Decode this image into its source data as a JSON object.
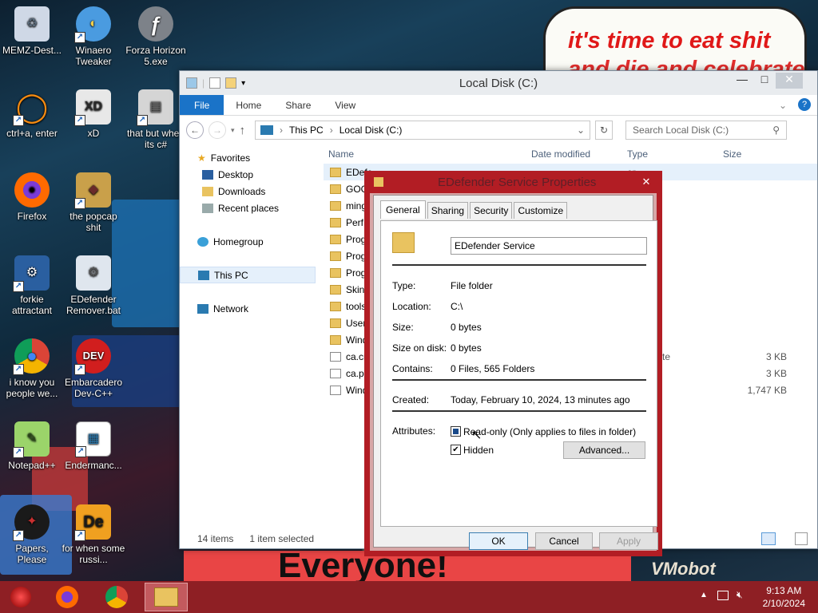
{
  "desktop": {
    "speech_line1": "it's time to eat shit",
    "speech_line2": "and die and celebrate",
    "poster_text": "Everyone!",
    "watermark_text": "VMobot",
    "icons": [
      {
        "label": "MEMZ-Dest...",
        "icon": "recycle-bin-icon",
        "color": "#cfd8e6",
        "glyph": "♻"
      },
      {
        "label": "Winaero Tweaker",
        "icon": "winaero-icon",
        "color": "#4a9be0",
        "glyph": "◐"
      },
      {
        "label": "Forza Horizon 5.exe",
        "icon": "flash-icon",
        "color": "#8a8f96",
        "glyph": "ƒ"
      },
      {
        "label": "ctrl+a, enter",
        "icon": "orange-ring-icon",
        "color": "#222",
        "glyph": "◯"
      },
      {
        "label": "xD",
        "icon": "hxd-icon",
        "color": "#e0e0e0",
        "glyph": "XD"
      },
      {
        "label": "that but when its c#",
        "icon": "folder-stack-icon",
        "color": "#d8d8d8",
        "glyph": "▤"
      },
      {
        "label": "Firefox",
        "icon": "firefox-icon",
        "color": "#ff6a00",
        "glyph": "◉"
      },
      {
        "label": "the popcap shit",
        "icon": "popcap-icon",
        "color": "#c9a04a",
        "glyph": "◆"
      },
      {
        "label": "forkie attractant",
        "icon": "settings-monitor-icon",
        "color": "#2a5fa0",
        "glyph": "⚙"
      },
      {
        "label": "EDefender Remover.bat",
        "icon": "batch-gear-icon",
        "color": "#dfe6ee",
        "glyph": "⚙"
      },
      {
        "label": "i know you people we...",
        "icon": "chrome-icon",
        "color": "#ffffff",
        "glyph": "●"
      },
      {
        "label": "Embarcadero Dev-C++",
        "icon": "devcpp-icon",
        "color": "#d11e1e",
        "glyph": "DEV"
      },
      {
        "label": "Notepad++",
        "icon": "notepadpp-icon",
        "color": "#9bd46a",
        "glyph": "✎"
      },
      {
        "label": "Endermanc...",
        "icon": "document-icon",
        "color": "#ffffff",
        "glyph": "▦"
      },
      {
        "label": "Papers, Please",
        "icon": "papers-please-icon",
        "color": "#6a1e1e",
        "glyph": "✦"
      },
      {
        "label": "for when some russi...",
        "icon": "de-icon",
        "color": "#f0a020",
        "glyph": "De"
      }
    ]
  },
  "explorer": {
    "title": "Local Disk (C:)",
    "ribbon_tabs": [
      "File",
      "Home",
      "Share",
      "View"
    ],
    "breadcrumb": [
      "This PC",
      "Local Disk (C:)"
    ],
    "search_placeholder": "Search Local Disk (C:)",
    "nav": {
      "favorites": "Favorites",
      "desktop": "Desktop",
      "downloads": "Downloads",
      "recent": "Recent places",
      "homegroup": "Homegroup",
      "this_pc": "This PC",
      "network": "Network"
    },
    "columns": {
      "name": "Name",
      "date": "Date modified",
      "type": "Type",
      "size": "Size"
    },
    "files": [
      {
        "name": "EDefe",
        "type": "er",
        "size": "",
        "kind": "folder"
      },
      {
        "name": "GOG",
        "type": "er",
        "size": "",
        "kind": "folder"
      },
      {
        "name": "ming",
        "type": "er",
        "size": "",
        "kind": "folder"
      },
      {
        "name": "PerfL",
        "type": "er",
        "size": "",
        "kind": "folder"
      },
      {
        "name": "Progr",
        "type": "er",
        "size": "",
        "kind": "folder"
      },
      {
        "name": "Progr",
        "type": "er",
        "size": "",
        "kind": "folder"
      },
      {
        "name": "Progr",
        "type": "er",
        "size": "",
        "kind": "folder"
      },
      {
        "name": "SkinF",
        "type": "er",
        "size": "",
        "kind": "folder"
      },
      {
        "name": "tools",
        "type": "er",
        "size": "",
        "kind": "folder"
      },
      {
        "name": "Users",
        "type": "er",
        "size": "",
        "kind": "folder"
      },
      {
        "name": "Wind",
        "type": "er",
        "size": "",
        "kind": "folder"
      },
      {
        "name": "ca.cr",
        "type": "Certificate",
        "size": "3 KB",
        "kind": "cert"
      },
      {
        "name": "ca.pe",
        "type": "",
        "size": "3 KB",
        "kind": "doc"
      },
      {
        "name": "Wind",
        "type": "",
        "size": "1,747 KB",
        "kind": "doc"
      }
    ],
    "status_items": "14 items",
    "status_selected": "1 item selected"
  },
  "dialog": {
    "title": "EDefender Service Properties",
    "tabs": [
      "General",
      "Sharing",
      "Security",
      "Customize"
    ],
    "folder_name": "EDefender Service",
    "type_label": "Type:",
    "type_value": "File folder",
    "location_label": "Location:",
    "location_value": "C:\\",
    "size_label": "Size:",
    "size_value": "0 bytes",
    "size_on_disk_label": "Size on disk:",
    "size_on_disk_value": "0 bytes",
    "contains_label": "Contains:",
    "contains_value": "0 Files, 565 Folders",
    "created_label": "Created:",
    "created_value": "Today, February 10, 2024, 13 minutes ago",
    "attributes_label": "Attributes:",
    "readonly_label": "Read-only (Only applies to files in folder)",
    "hidden_label": "Hidden",
    "readonly_state": "indeterminate",
    "hidden_checked": true,
    "advanced_label": "Advanced...",
    "ok_label": "OK",
    "cancel_label": "Cancel",
    "apply_label": "Apply"
  },
  "taskbar": {
    "time": "9:13 AM",
    "date": "2/10/2024",
    "apps": [
      "start-ornament-icon",
      "firefox-icon",
      "chrome-icon",
      "file-explorer-icon"
    ]
  }
}
